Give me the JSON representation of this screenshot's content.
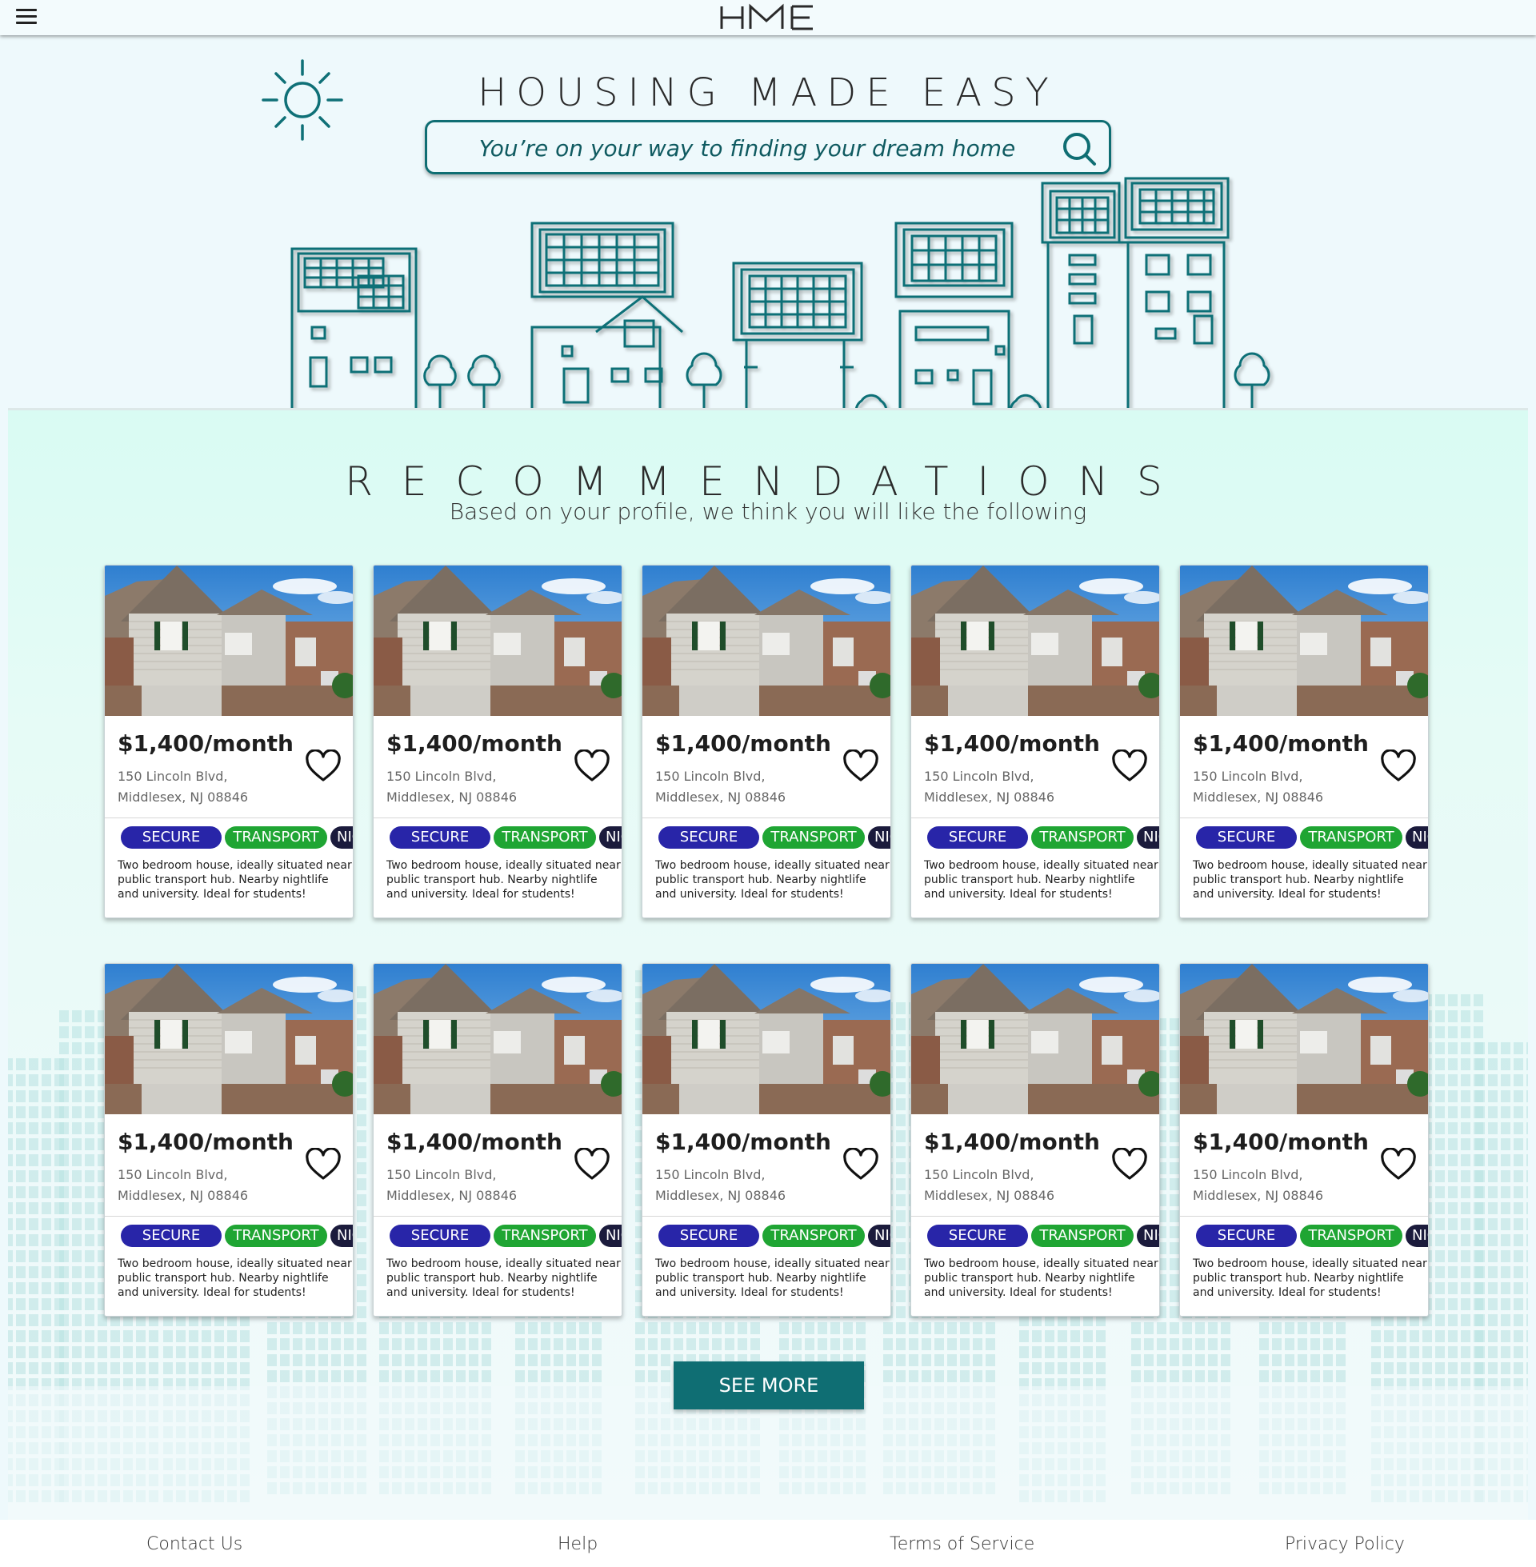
{
  "header": {
    "logo_text": "HME",
    "menu_icon": "hamburger-menu-icon"
  },
  "hero": {
    "title": "HOUSING MADE EASY",
    "search": {
      "placeholder": "You’re on your way to finding your dream home",
      "value": "",
      "icon": "search-icon"
    }
  },
  "recommendations": {
    "title": "RECOMMENDATIONS",
    "subtitle": "Based on your profile, we think you will like the following",
    "listings": [
      {
        "price": "$1,400/month",
        "address_line1": "150 Lincoln Blvd,",
        "address_line2": "Middlesex, NJ 08846",
        "tags": [
          "SECURE",
          "TRANSPORT",
          "NIGHTLIFE"
        ],
        "description": "Two bedroom house, ideally situated near public transport hub. Nearby nightlife and university. Ideal for students!"
      },
      {
        "price": "$1,400/month",
        "address_line1": "150 Lincoln Blvd,",
        "address_line2": "Middlesex, NJ 08846",
        "tags": [
          "SECURE",
          "TRANSPORT",
          "NIGHTLIFE"
        ],
        "description": "Two bedroom house, ideally situated near public transport hub. Nearby nightlife and university. Ideal for students!"
      },
      {
        "price": "$1,400/month",
        "address_line1": "150 Lincoln Blvd,",
        "address_line2": "Middlesex, NJ 08846",
        "tags": [
          "SECURE",
          "TRANSPORT",
          "NIGHTLIFE"
        ],
        "description": "Two bedroom house, ideally situated near public transport hub. Nearby nightlife and university. Ideal for students!"
      },
      {
        "price": "$1,400/month",
        "address_line1": "150 Lincoln Blvd,",
        "address_line2": "Middlesex, NJ 08846",
        "tags": [
          "SECURE",
          "TRANSPORT",
          "NIGHTLIFE"
        ],
        "description": "Two bedroom house, ideally situated near public transport hub. Nearby nightlife and university. Ideal for students!"
      },
      {
        "price": "$1,400/month",
        "address_line1": "150 Lincoln Blvd,",
        "address_line2": "Middlesex, NJ 08846",
        "tags": [
          "SECURE",
          "TRANSPORT",
          "NIGHTLIFE"
        ],
        "description": "Two bedroom house, ideally situated near public transport hub. Nearby nightlife and university. Ideal for students!"
      },
      {
        "price": "$1,400/month",
        "address_line1": "150 Lincoln Blvd,",
        "address_line2": "Middlesex, NJ 08846",
        "tags": [
          "SECURE",
          "TRANSPORT",
          "NIGHTLIFE"
        ],
        "description": "Two bedroom house, ideally situated near public transport hub. Nearby nightlife and university. Ideal for students!"
      },
      {
        "price": "$1,400/month",
        "address_line1": "150 Lincoln Blvd,",
        "address_line2": "Middlesex, NJ 08846",
        "tags": [
          "SECURE",
          "TRANSPORT",
          "NIGHTLIFE"
        ],
        "description": "Two bedroom house, ideally situated near public transport hub. Nearby nightlife and university. Ideal for students!"
      },
      {
        "price": "$1,400/month",
        "address_line1": "150 Lincoln Blvd,",
        "address_line2": "Middlesex, NJ 08846",
        "tags": [
          "SECURE",
          "TRANSPORT",
          "NIGHTLIFE"
        ],
        "description": "Two bedroom house, ideally situated near public transport hub. Nearby nightlife and university. Ideal for students!"
      },
      {
        "price": "$1,400/month",
        "address_line1": "150 Lincoln Blvd,",
        "address_line2": "Middlesex, NJ 08846",
        "tags": [
          "SECURE",
          "TRANSPORT",
          "NIGHTLIFE"
        ],
        "description": "Two bedroom house, ideally situated near public transport hub. Nearby nightlife and university. Ideal for students!"
      },
      {
        "price": "$1,400/month",
        "address_line1": "150 Lincoln Blvd,",
        "address_line2": "Middlesex, NJ 08846",
        "tags": [
          "SECURE",
          "TRANSPORT",
          "NIGHTLIFE"
        ],
        "description": "Two bedroom house, ideally situated near public transport hub. Nearby nightlife and university. Ideal for students!"
      }
    ],
    "see_more_label": "SEE MORE"
  },
  "footer": {
    "links": [
      "Contact Us",
      "Help",
      "Terms of Service",
      "Privacy Policy"
    ]
  },
  "colors": {
    "brand_teal": "#0f6e73",
    "tag_secure": "#2825a8",
    "tag_transport": "#1fa533",
    "tag_nightlife": "#1b1b3c",
    "background": "#eef9fc",
    "reco_background": "#d9fbf3"
  }
}
